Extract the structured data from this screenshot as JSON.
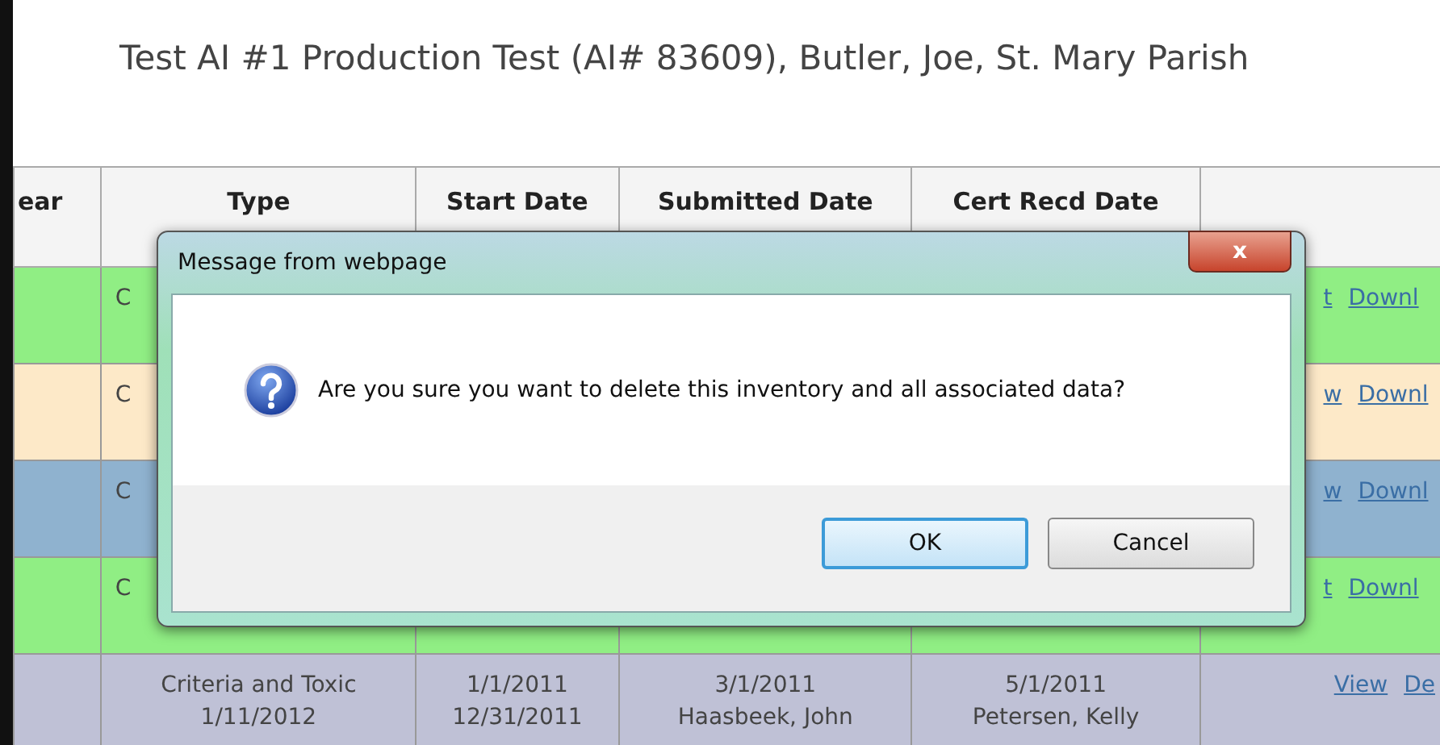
{
  "page_title": "Test AI #1 Production Test (AI# 83609), Butler, Joe, St. Mary Parish",
  "table": {
    "columns": [
      "ear",
      "Type",
      "Start Date",
      "Submitted Date",
      "Cert Recd Date",
      ""
    ],
    "rows": [
      {
        "color": "#90ee84",
        "cells": [
          "",
          [
            "C"
          ],
          [],
          [],
          []
        ],
        "links": [
          "t",
          "Downl"
        ]
      },
      {
        "color": "#fde9c8",
        "cells": [
          "",
          [
            "C"
          ],
          [],
          [],
          []
        ],
        "links": [
          "w",
          "Downl"
        ]
      },
      {
        "color": "#8fb2cf",
        "cells": [
          "",
          [
            "C"
          ],
          [],
          [],
          []
        ],
        "links": [
          "w",
          "Downl"
        ]
      },
      {
        "color": "#90ee84",
        "cells": [
          "",
          [
            "C"
          ],
          [],
          [],
          []
        ],
        "links": [
          "t",
          "Downl"
        ]
      },
      {
        "color": "#bfc1d6",
        "cells": [
          "",
          [
            "Criteria and Toxic",
            "1/11/2012"
          ],
          [
            "1/1/2011",
            "12/31/2011"
          ],
          [
            "3/1/2011",
            "Haasbeek, John"
          ],
          [
            "5/1/2011",
            "Petersen, Kelly"
          ]
        ],
        "links": [
          "View",
          "De"
        ]
      }
    ]
  },
  "dialog": {
    "title": "Message from webpage",
    "close": "x",
    "message": "Are you sure you want to delete this inventory and all associated data?",
    "buttons": [
      {
        "label": "OK",
        "selected": true
      },
      {
        "label": "Cancel",
        "selected": false
      }
    ]
  }
}
